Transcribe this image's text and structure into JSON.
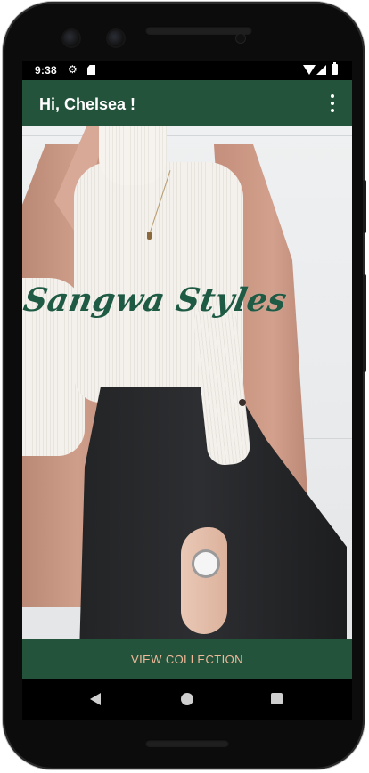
{
  "status_bar": {
    "time": "9:38",
    "icons": [
      "gear-icon",
      "sd-card-icon",
      "wifi-icon",
      "signal-icon",
      "battery-icon"
    ]
  },
  "app_bar": {
    "title": "Hi, Chelsea !",
    "menu_icon": "more-vert-icon"
  },
  "hero": {
    "brand_text": "Sangwa Styles"
  },
  "cta": {
    "label": "VIEW COLLECTION"
  },
  "nav_bar": {
    "icons": [
      "back-icon",
      "home-icon",
      "recents-icon"
    ]
  },
  "colors": {
    "primary": "#24533b",
    "accent_text": "#efb99a",
    "brand_script": "#1f5a45"
  }
}
